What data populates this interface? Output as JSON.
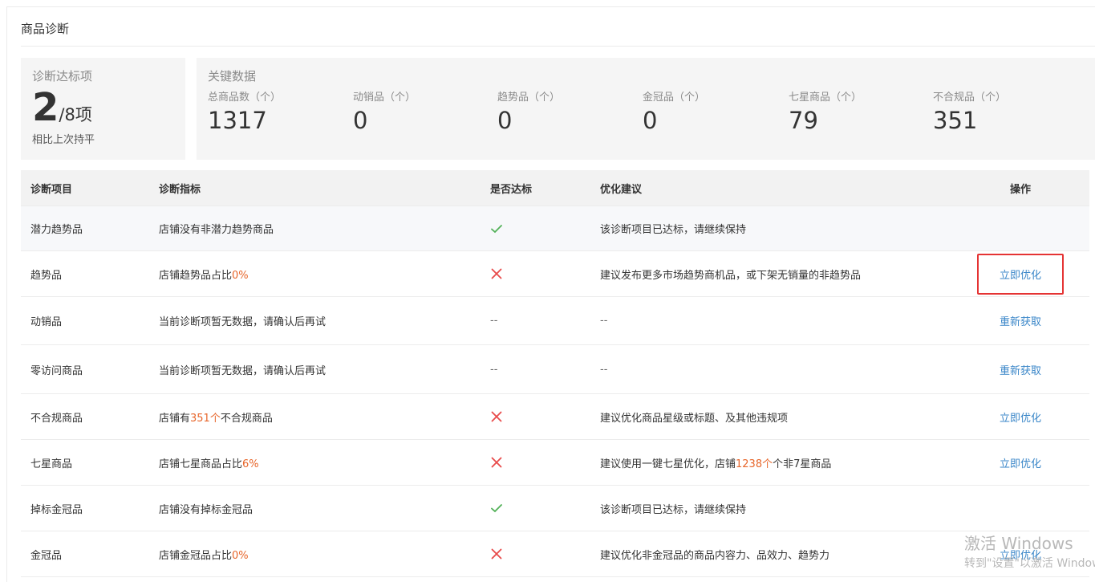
{
  "panel": {
    "title": "商品诊断"
  },
  "score_card": {
    "label": "诊断达标项",
    "achieved": "2",
    "total": "/8项",
    "comparison": "相比上次持平"
  },
  "key_data": {
    "label": "关键数据",
    "metrics": [
      {
        "label": "总商品数（个）",
        "value": "1317"
      },
      {
        "label": "动销品（个）",
        "value": "0"
      },
      {
        "label": "趋势品（个）",
        "value": "0"
      },
      {
        "label": "金冠品（个）",
        "value": "0"
      },
      {
        "label": "七星商品（个）",
        "value": "79"
      },
      {
        "label": "不合规品（个）",
        "value": "351"
      }
    ]
  },
  "table": {
    "headers": [
      "诊断项目",
      "诊断指标",
      "是否达标",
      "优化建议",
      "操作"
    ],
    "rows": [
      {
        "item": "潜力趋势品",
        "metric_pre": "店铺没有非潜力趋势商品",
        "metric_hl": "",
        "metric_post": "",
        "status": "pass",
        "status_text": "",
        "advice_pre": "该诊断项目已达标，请继续保持",
        "advice_hl": "",
        "advice_post": "",
        "action": ""
      },
      {
        "item": "趋势品",
        "metric_pre": "店铺趋势品占比",
        "metric_hl": "0%",
        "metric_post": "",
        "status": "fail",
        "status_text": "",
        "advice_pre": "建议发布更多市场趋势商机品，或下架无销量的非趋势品",
        "advice_hl": "",
        "advice_post": "",
        "action": "立即优化"
      },
      {
        "item": "动销品",
        "metric_pre": "当前诊断项暂无数据，请确认后再试",
        "metric_hl": "",
        "metric_post": "",
        "status": "none",
        "status_text": "--",
        "advice_pre": "--",
        "advice_hl": "",
        "advice_post": "",
        "action": "重新获取"
      },
      {
        "item": "零访问商品",
        "metric_pre": "当前诊断项暂无数据，请确认后再试",
        "metric_hl": "",
        "metric_post": "",
        "status": "none",
        "status_text": "--",
        "advice_pre": "--",
        "advice_hl": "",
        "advice_post": "",
        "action": "重新获取"
      },
      {
        "item": "不合规商品",
        "metric_pre": "店铺有",
        "metric_hl": "351个",
        "metric_post": "不合规商品",
        "status": "fail",
        "status_text": "",
        "advice_pre": "建议优化商品星级或标题、及其他违规项",
        "advice_hl": "",
        "advice_post": "",
        "action": "立即优化"
      },
      {
        "item": "七星商品",
        "metric_pre": "店铺七星商品占比",
        "metric_hl": "6%",
        "metric_post": "",
        "status": "fail",
        "status_text": "",
        "advice_pre": "建议使用一键七星优化，店铺",
        "advice_hl": "1238个",
        "advice_post": "个非7星商品",
        "action": "立即优化"
      },
      {
        "item": "掉标金冠品",
        "metric_pre": "店铺没有掉标金冠品",
        "metric_hl": "",
        "metric_post": "",
        "status": "pass",
        "status_text": "",
        "advice_pre": "该诊断项目已达标，请继续保持",
        "advice_hl": "",
        "advice_post": "",
        "action": ""
      },
      {
        "item": "金冠品",
        "metric_pre": "店铺金冠品占比",
        "metric_hl": "0%",
        "metric_post": "",
        "status": "fail",
        "status_text": "",
        "advice_pre": "建议优化非金冠品的商品内容力、品效力、趋势力",
        "advice_hl": "",
        "advice_post": "",
        "action": "立即优化"
      }
    ]
  },
  "watermark": {
    "line1": "激活 Windows",
    "line2": "转到\"设置\"以激活 Windows。"
  },
  "colors": {
    "highlight": "#e7662b",
    "link": "#3a86c8",
    "pass": "#52b158",
    "fail": "#e84a4a",
    "focus_box": "#e53333"
  },
  "icons": {
    "pass": "check-icon",
    "fail": "cross-icon"
  }
}
